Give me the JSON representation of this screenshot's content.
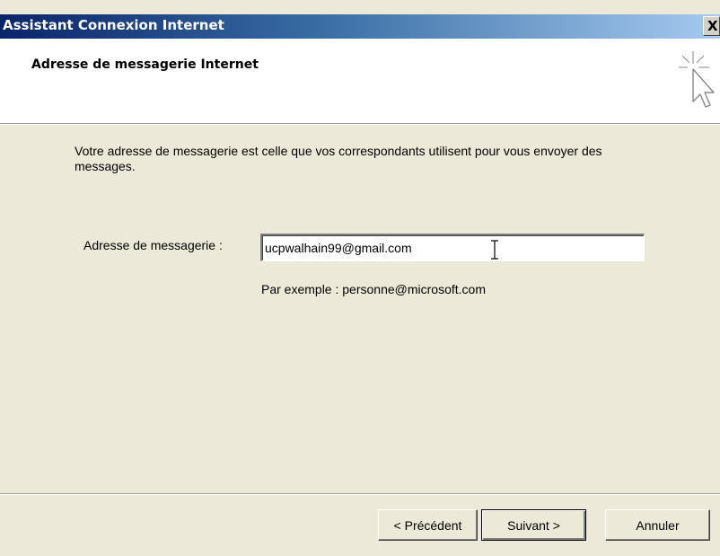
{
  "window": {
    "title": "Assistant Connexion Internet",
    "close_glyph": "X"
  },
  "header": {
    "title": "Adresse de messagerie Internet",
    "icon": "wizard-cursor-icon"
  },
  "body": {
    "description": "Votre adresse de messagerie est celle que vos correspondants utilisent pour vous envoyer des messages.",
    "email_label": "Adresse de messagerie :",
    "email_value": "ucpwalhain99@gmail.com",
    "example": "Par exemple : personne@microsoft.com"
  },
  "buttons": {
    "back": "< Précédent",
    "next": "Suivant >",
    "cancel": "Annuler"
  },
  "colors": {
    "title_bar_start": "#0A246A",
    "title_bar_end": "#A6CAF0",
    "dialog_background": "#ECE9D8"
  }
}
